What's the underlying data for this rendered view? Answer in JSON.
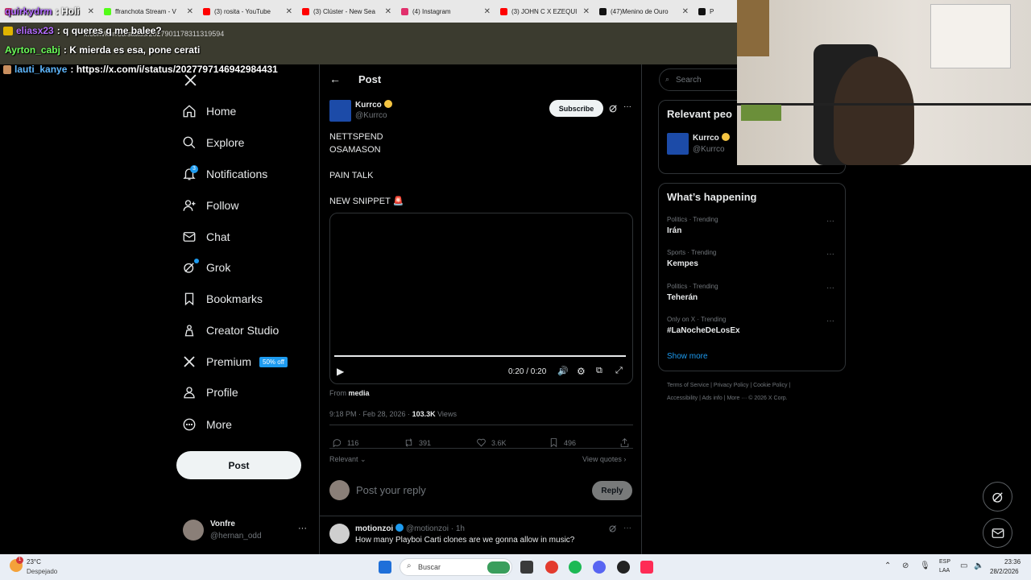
{
  "browser": {
    "tabs": [
      {
        "label": "Instagram",
        "favicon_color": "#e1306c"
      },
      {
        "label": "ffranchota Stream - V",
        "favicon_color": "#53fc18"
      },
      {
        "label": "(3) rosita - YouTube",
        "favicon_color": "#ff0000"
      },
      {
        "label": "(3) Clúster - New Sea",
        "favicon_color": "#ff0000"
      },
      {
        "label": "(4) Instagram",
        "favicon_color": "#e1306c"
      },
      {
        "label": "(3) JOHN C X EZEQUI",
        "favicon_color": "#ff0000"
      },
      {
        "label": "(47)Menino de Ouro",
        "favicon_color": "#111111"
      },
      {
        "label": "P",
        "favicon_color": "#111111"
      }
    ],
    "url": "x.com/kurrco/status/2027901178311319594"
  },
  "chat": [
    {
      "user": "quirkydrm",
      "message": ": Holi",
      "color": "#b46cff"
    },
    {
      "user": "eliasx23",
      "message": ": q queres q me balee?",
      "color": "#b46cff"
    },
    {
      "user": "Ayrton_cabj",
      "message": ": K mierda es esa, pone cerati",
      "color": "#6cff5a"
    },
    {
      "user": "lauti_kanye",
      "message": ": https://x.com/i/status/2027797146942984431",
      "color": "#5fb8ff"
    }
  ],
  "nav": {
    "items": [
      {
        "label": "Home",
        "icon": "home-icon"
      },
      {
        "label": "Explore",
        "icon": "search-icon"
      },
      {
        "label": "Notifications",
        "icon": "bell-icon"
      },
      {
        "label": "Follow",
        "icon": "person-add-icon"
      },
      {
        "label": "Chat",
        "icon": "mail-icon"
      },
      {
        "label": "Grok",
        "icon": "grok-icon"
      },
      {
        "label": "Bookmarks",
        "icon": "bookmark-icon"
      },
      {
        "label": "Creator Studio",
        "icon": "creator-icon"
      },
      {
        "label": "Premium",
        "icon": "x-icon"
      },
      {
        "label": "Profile",
        "icon": "person-icon"
      },
      {
        "label": "More",
        "icon": "more-circle-icon"
      }
    ],
    "notifications_badge": "3",
    "premium_badge": "50% off",
    "post_label": "Post",
    "account": {
      "name": "Vonfre",
      "handle": "@hernan_odd"
    }
  },
  "post": {
    "header": "Post",
    "author": {
      "name": "Kurrco",
      "handle": "@Kurrco",
      "subscribe_label": "Subscribe"
    },
    "text_lines": [
      "NETTSPEND",
      "OSAMASON",
      "",
      "PAIN TALK",
      "",
      "NEW SNIPPET 🚨"
    ],
    "video": {
      "time": "0:20 / 0:20",
      "progress": 1.0
    },
    "from_label": "From",
    "from_source": "media",
    "timestamp": "9:18 PM · Feb 28, 2026 · ",
    "views_count": "103.3K",
    "views_label": " Views",
    "actions": {
      "replies": "116",
      "reposts": "391",
      "likes": "3.6K",
      "bookmarks": "496"
    },
    "sort_label": "Relevant",
    "view_quotes": "View quotes",
    "reply_placeholder": "Post your reply",
    "reply_button": "Reply"
  },
  "reply": {
    "name": "motionzoi",
    "handle": "@motionzoi · 1h",
    "text": "How many Playboi Carti clones are we gonna allow in music?"
  },
  "sidebar": {
    "search_placeholder": "Search",
    "relevant_title": "Relevant peo",
    "relevant_person": {
      "name": "Kurrco",
      "handle": "@Kurrco"
    },
    "happening_title": "What’s happening",
    "trends": [
      {
        "category": "Politics · Trending",
        "name": "Irán"
      },
      {
        "category": "Sports · Trending",
        "name": "Kempes"
      },
      {
        "category": "Politics · Trending",
        "name": "Teherán"
      },
      {
        "category": "Only on X · Trending",
        "name": "#LaNocheDeLosEx"
      }
    ],
    "show_more": "Show more",
    "footer_line1": "Terms of Service  |  Privacy Policy  |  Cookie Policy  |",
    "footer_line2": "Accessibility  |  Ads info  |  More ···  © 2026 X Corp."
  },
  "taskbar": {
    "weather_temp": "23°C",
    "weather_desc": "Despejado",
    "search_label": "Buscar",
    "lang": "ESP",
    "lang2": "LAA",
    "time": "23:36",
    "date": "28/2/2026"
  }
}
